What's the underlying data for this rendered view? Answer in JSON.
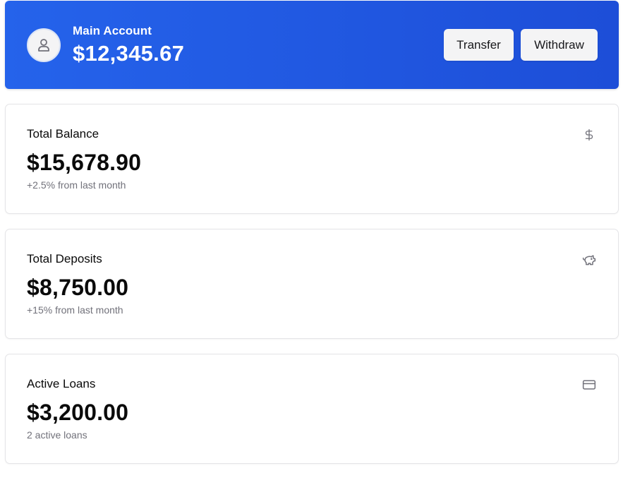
{
  "header": {
    "account_name": "Main Account",
    "account_balance": "$12,345.67",
    "transfer_label": "Transfer",
    "withdraw_label": "Withdraw",
    "avatar_icon": "user-icon",
    "gradient_start": "#2563eb",
    "gradient_end": "#1d4ed8"
  },
  "cards": [
    {
      "title": "Total Balance",
      "value": "$15,678.90",
      "subtitle": "+2.5% from last month",
      "icon": "dollar-sign-icon"
    },
    {
      "title": "Total Deposits",
      "value": "$8,750.00",
      "subtitle": "+15% from last month",
      "icon": "piggy-bank-icon"
    },
    {
      "title": "Active Loans",
      "value": "$3,200.00",
      "subtitle": "2 active loans",
      "icon": "credit-card-icon"
    }
  ]
}
